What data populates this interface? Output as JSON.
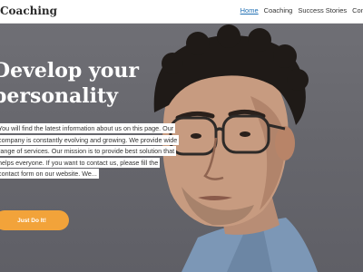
{
  "header": {
    "brand": "Coaching",
    "nav": [
      {
        "label": "Home",
        "active": true
      },
      {
        "label": "Coaching",
        "active": false
      },
      {
        "label": "Success Stories",
        "active": false
      },
      {
        "label": "Contact",
        "active": false
      }
    ]
  },
  "hero": {
    "title_line1": "Develop your",
    "title_line2": "personality",
    "text": "You will find the latest information about us on this page. Our company is constantly evolving and growing. We provide wide range of services. Our mission is to provide best solution that helps everyone. If you want to contact us, please fill the contact form on our website. We...",
    "cta_label": "Just Do It!",
    "colors": {
      "accent": "#f2a33a",
      "nav_active": "#1f6fb3",
      "hero_bg": "#6a6a70"
    }
  }
}
